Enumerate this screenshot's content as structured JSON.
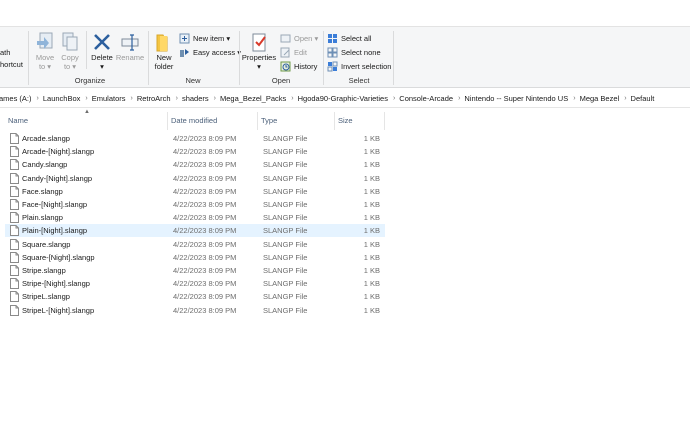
{
  "ribbon": {
    "left_partial": {
      "line1": "ath",
      "line2": "hortcut"
    },
    "organize": {
      "label": "Organize",
      "move_to": {
        "line1": "Move",
        "line2": "to"
      },
      "copy_to": {
        "line1": "Copy",
        "line2": "to"
      },
      "delete": "Delete",
      "rename": "Rename"
    },
    "new": {
      "label": "New",
      "new_folder": {
        "line1": "New",
        "line2": "folder"
      },
      "new_item": "New item",
      "easy_access": "Easy access"
    },
    "open": {
      "label": "Open",
      "properties": "Properties",
      "open": "Open",
      "edit": "Edit",
      "history": "History"
    },
    "select": {
      "label": "Select",
      "select_all": "Select all",
      "select_none": "Select none",
      "invert_selection": "Invert selection"
    }
  },
  "breadcrumb": [
    "ames (A:)",
    "LaunchBox",
    "Emulators",
    "RetroArch",
    "shaders",
    "Mega_Bezel_Packs",
    "Hgoda90-Graphic-Varieties",
    "Console-Arcade",
    "Nintendo -- Super Nintendo US",
    "Mega Bezel",
    "Default"
  ],
  "columns": {
    "name": "Name",
    "date": "Date modified",
    "type": "Type",
    "size": "Size"
  },
  "files": [
    {
      "name": "Arcade.slangp",
      "date": "4/22/2023 8:09 PM",
      "type": "SLANGP File",
      "size": "1 KB"
    },
    {
      "name": "Arcade-[Night].slangp",
      "date": "4/22/2023 8:09 PM",
      "type": "SLANGP File",
      "size": "1 KB"
    },
    {
      "name": "Candy.slangp",
      "date": "4/22/2023 8:09 PM",
      "type": "SLANGP File",
      "size": "1 KB"
    },
    {
      "name": "Candy-[Night].slangp",
      "date": "4/22/2023 8:09 PM",
      "type": "SLANGP File",
      "size": "1 KB"
    },
    {
      "name": "Face.slangp",
      "date": "4/22/2023 8:09 PM",
      "type": "SLANGP File",
      "size": "1 KB"
    },
    {
      "name": "Face-[Night].slangp",
      "date": "4/22/2023 8:09 PM",
      "type": "SLANGP File",
      "size": "1 KB"
    },
    {
      "name": "Plain.slangp",
      "date": "4/22/2023 8:09 PM",
      "type": "SLANGP File",
      "size": "1 KB"
    },
    {
      "name": "Plain-[Night].slangp",
      "date": "4/22/2023 8:09 PM",
      "type": "SLANGP File",
      "size": "1 KB",
      "selected": true
    },
    {
      "name": "Square.slangp",
      "date": "4/22/2023 8:09 PM",
      "type": "SLANGP File",
      "size": "1 KB"
    },
    {
      "name": "Square-[Night].slangp",
      "date": "4/22/2023 8:09 PM",
      "type": "SLANGP File",
      "size": "1 KB"
    },
    {
      "name": "Stripe.slangp",
      "date": "4/22/2023 8:09 PM",
      "type": "SLANGP File",
      "size": "1 KB"
    },
    {
      "name": "Stripe-[Night].slangp",
      "date": "4/22/2023 8:09 PM",
      "type": "SLANGP File",
      "size": "1 KB"
    },
    {
      "name": "StripeL.slangp",
      "date": "4/22/2023 8:09 PM",
      "type": "SLANGP File",
      "size": "1 KB"
    },
    {
      "name": "StripeL-[Night].slangp",
      "date": "4/22/2023 8:09 PM",
      "type": "SLANGP File",
      "size": "1 KB"
    }
  ],
  "colors": {
    "selected_row": "#e5f3ff",
    "accent": "#1a73e8"
  }
}
